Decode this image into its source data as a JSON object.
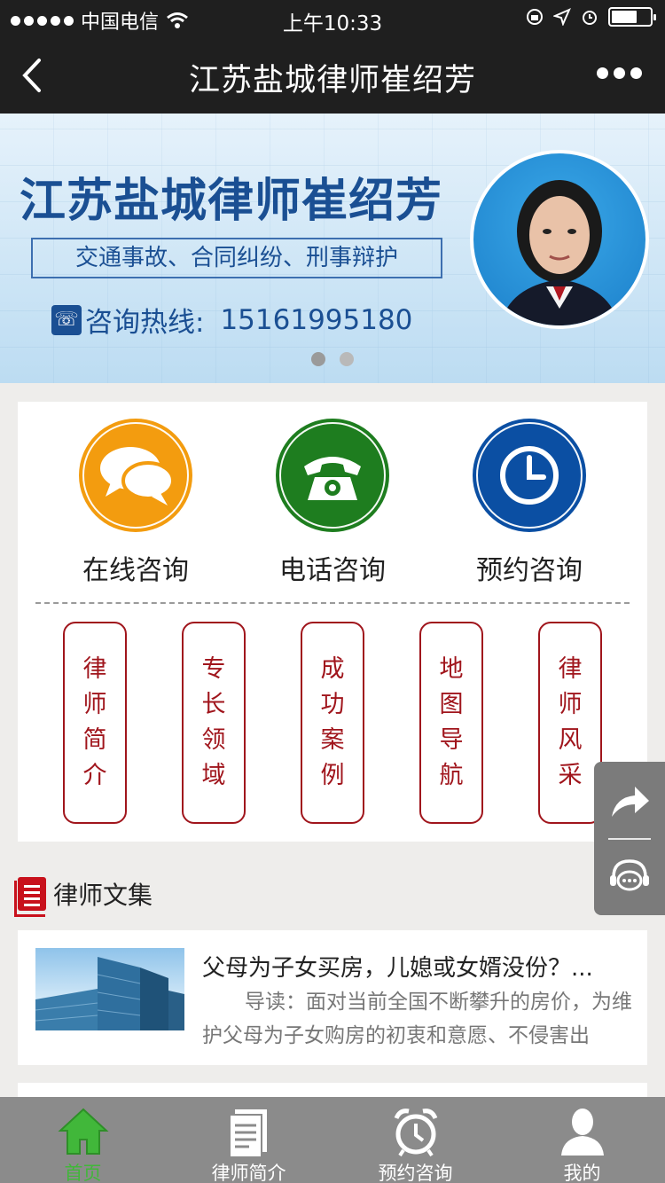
{
  "status_bar": {
    "carrier": "中国电信",
    "time": "上午10:33"
  },
  "navbar": {
    "title": "江苏盐城律师崔绍芳",
    "back_icon": "chevron-left-icon",
    "more_icon": "more-dots-icon"
  },
  "banner": {
    "headline": "江苏盐城律师崔绍芳",
    "subline": "交通事故、合同纠纷、刑事辩护",
    "hotline_label": "咨询热线:",
    "hotline_number": "15161995180",
    "slides_total": 2,
    "slide_active": 1
  },
  "quick_actions": [
    {
      "label": "在线咨询",
      "icon": "chat-bubbles-icon",
      "color": "#f39c0f"
    },
    {
      "label": "电话咨询",
      "icon": "telephone-icon",
      "color": "#1e7d1f"
    },
    {
      "label": "预约咨询",
      "icon": "clock-icon",
      "color": "#0b4fa3"
    }
  ],
  "menu_pills": [
    {
      "label": "律师简介"
    },
    {
      "label": "专长领域"
    },
    {
      "label": "成功案例"
    },
    {
      "label": "地图导航"
    },
    {
      "label": "律师风采"
    }
  ],
  "section": {
    "title": "律师文集"
  },
  "articles": [
    {
      "title": "父母为子女买房，儿媳或女婿没份？...",
      "intro": "导读：面对当前全国不断攀升的房价，为维护父母为子女购房的初衷和意愿、不侵害出"
    }
  ],
  "tabbar": [
    {
      "label": "首页",
      "icon": "home-icon",
      "active": true
    },
    {
      "label": "律师简介",
      "icon": "document-icon",
      "active": false
    },
    {
      "label": "预约咨询",
      "icon": "alarm-clock-icon",
      "active": false
    },
    {
      "label": "我的",
      "icon": "user-icon",
      "active": false
    }
  ],
  "colors": {
    "accent_red": "#a0151c",
    "tab_active": "#41b73a",
    "bar_dark": "#1f1f1f"
  }
}
